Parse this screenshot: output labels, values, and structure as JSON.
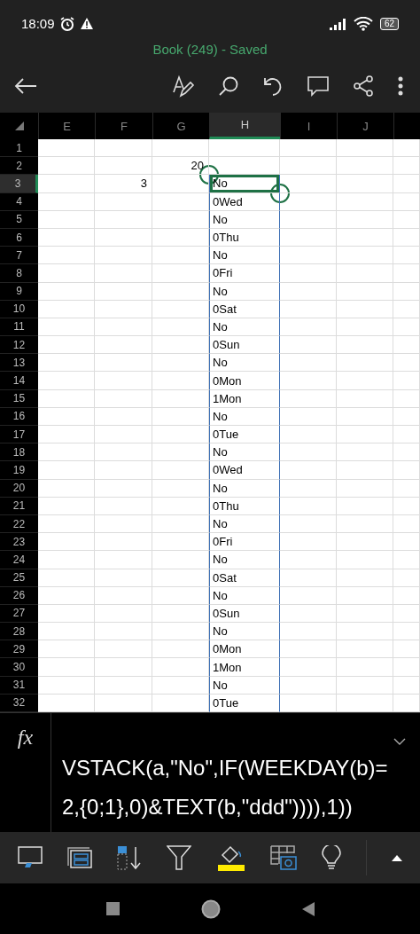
{
  "status_bar": {
    "time": "18:09",
    "battery": "62"
  },
  "window": {
    "title": "Book (249) - Saved"
  },
  "columns": [
    {
      "label": "E",
      "selected": false
    },
    {
      "label": "F",
      "selected": false
    },
    {
      "label": "G",
      "selected": false
    },
    {
      "label": "H",
      "selected": true
    },
    {
      "label": "I",
      "selected": false
    },
    {
      "label": "J",
      "selected": false
    }
  ],
  "rows": [
    {
      "number": "1",
      "selected": false,
      "spill": false
    },
    {
      "number": "2",
      "selected": false,
      "spill": false,
      "g": "20"
    },
    {
      "number": "3",
      "selected": true,
      "spill": true,
      "f": "3",
      "h": "No"
    },
    {
      "number": "4",
      "selected": false,
      "spill": true,
      "h": "0Wed"
    },
    {
      "number": "5",
      "selected": false,
      "spill": true,
      "h": "No"
    },
    {
      "number": "6",
      "selected": false,
      "spill": true,
      "h": "0Thu"
    },
    {
      "number": "7",
      "selected": false,
      "spill": true,
      "h": "No"
    },
    {
      "number": "8",
      "selected": false,
      "spill": true,
      "h": "0Fri"
    },
    {
      "number": "9",
      "selected": false,
      "spill": true,
      "h": "No"
    },
    {
      "number": "10",
      "selected": false,
      "spill": true,
      "h": "0Sat"
    },
    {
      "number": "11",
      "selected": false,
      "spill": true,
      "h": "No"
    },
    {
      "number": "12",
      "selected": false,
      "spill": true,
      "h": "0Sun"
    },
    {
      "number": "13",
      "selected": false,
      "spill": true,
      "h": "No"
    },
    {
      "number": "14",
      "selected": false,
      "spill": true,
      "h": "0Mon"
    },
    {
      "number": "15",
      "selected": false,
      "spill": true,
      "h": "1Mon"
    },
    {
      "number": "16",
      "selected": false,
      "spill": true,
      "h": "No"
    },
    {
      "number": "17",
      "selected": false,
      "spill": true,
      "h": "0Tue"
    },
    {
      "number": "18",
      "selected": false,
      "spill": true,
      "h": "No"
    },
    {
      "number": "19",
      "selected": false,
      "spill": true,
      "h": "0Wed"
    },
    {
      "number": "20",
      "selected": false,
      "spill": true,
      "h": "No"
    },
    {
      "number": "21",
      "selected": false,
      "spill": true,
      "h": "0Thu"
    },
    {
      "number": "22",
      "selected": false,
      "spill": true,
      "h": "No"
    },
    {
      "number": "23",
      "selected": false,
      "spill": true,
      "h": "0Fri"
    },
    {
      "number": "24",
      "selected": false,
      "spill": true,
      "h": "No"
    },
    {
      "number": "25",
      "selected": false,
      "spill": true,
      "h": "0Sat"
    },
    {
      "number": "26",
      "selected": false,
      "spill": true,
      "h": "No"
    },
    {
      "number": "27",
      "selected": false,
      "spill": true,
      "h": "0Sun"
    },
    {
      "number": "28",
      "selected": false,
      "spill": true,
      "h": "No"
    },
    {
      "number": "29",
      "selected": false,
      "spill": true,
      "h": "0Mon"
    },
    {
      "number": "30",
      "selected": false,
      "spill": true,
      "h": "1Mon"
    },
    {
      "number": "31",
      "selected": false,
      "spill": true,
      "h": "No"
    },
    {
      "number": "32",
      "selected": false,
      "spill": true,
      "h": "0Tue"
    }
  ],
  "formula_bar": {
    "icon": "fx",
    "lines": [
      "VSTACK(a,\"No\",IF(WEEKDAY(b)=",
      "2,{0;1},0)&TEXT(b,\"ddd\")))),1))"
    ]
  }
}
